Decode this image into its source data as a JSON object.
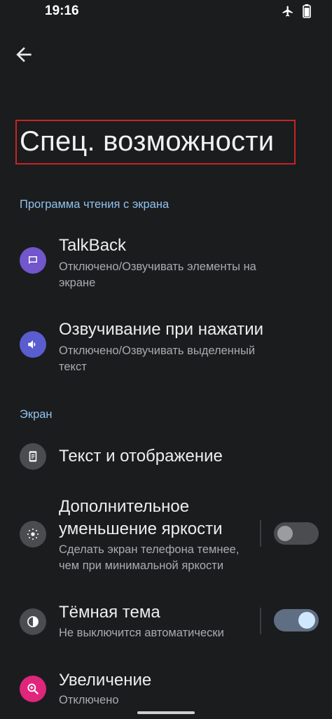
{
  "status_bar": {
    "time": "19:16",
    "icons": [
      "airplane-icon",
      "battery-icon"
    ]
  },
  "header": {
    "back_icon": "arrow-back-icon",
    "title": "Спец. возможности"
  },
  "sections": [
    {
      "label": "Программа чтения с экрана",
      "items": [
        {
          "title": "TalkBack",
          "subtitle_lines": [
            "Отключено/Озвучивать элементы на",
            "экране"
          ],
          "icon": "talkback-icon"
        },
        {
          "title": "Озвучивание при нажатии",
          "subtitle_lines": [
            "Отключено/Озвучивать выделенный",
            "текст"
          ],
          "icon": "select-to-speak-icon"
        }
      ]
    },
    {
      "label": "Экран",
      "items": [
        {
          "title": "Текст и отображение",
          "icon": "text-display-icon"
        },
        {
          "title_lines": [
            "Дополнительное",
            "уменьшение яркости"
          ],
          "subtitle_lines": [
            "Сделать экран телефона темнее,",
            "чем при минимальной яркости"
          ],
          "icon": "extra-dim-icon",
          "toggle_on": false
        },
        {
          "title": "Тёмная тема",
          "subtitle_lines": [
            "Не выключится автоматически"
          ],
          "icon": "dark-theme-icon",
          "toggle_on": true
        },
        {
          "title": "Увеличение",
          "subtitle_lines": [
            "Отключено"
          ],
          "icon": "magnification-icon"
        }
      ]
    }
  ],
  "colors": {
    "background": "#1b1c1e",
    "accent": "#8fc3ee",
    "highlight_border": "#c72424"
  }
}
